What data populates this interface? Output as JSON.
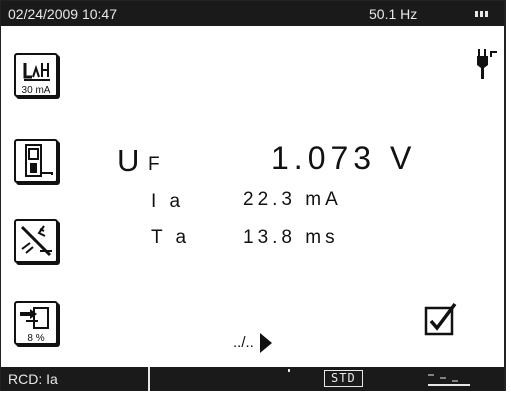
{
  "status_bar": {
    "datetime": "02/24/2009 10:47",
    "frequency": "50.1 Hz",
    "battery_icon": "battery-icon"
  },
  "side_buttons": [
    {
      "name": "rcd-current-icon",
      "sub_label": "30 mA"
    },
    {
      "name": "rcd-device-icon",
      "sub_label": ""
    },
    {
      "name": "disconnect-icon",
      "sub_label": ""
    },
    {
      "name": "exit-icon",
      "sub_label": "8 %"
    }
  ],
  "readings": {
    "uf": {
      "symbol": "U",
      "subscript": "F",
      "value": "1.073 V"
    },
    "ia": {
      "label": "I a",
      "value": "22.3 mA"
    },
    "ta": {
      "label": "T a",
      "value": "13.8 ms"
    }
  },
  "page_indicator": "../..",
  "bottom_bar": {
    "function": "RCD: Ia",
    "mode": "STD"
  },
  "check_result": "pass",
  "colors": {
    "bar_bg": "#1a1a1a",
    "bar_text": "#e8e8e8",
    "ink": "#111111"
  }
}
